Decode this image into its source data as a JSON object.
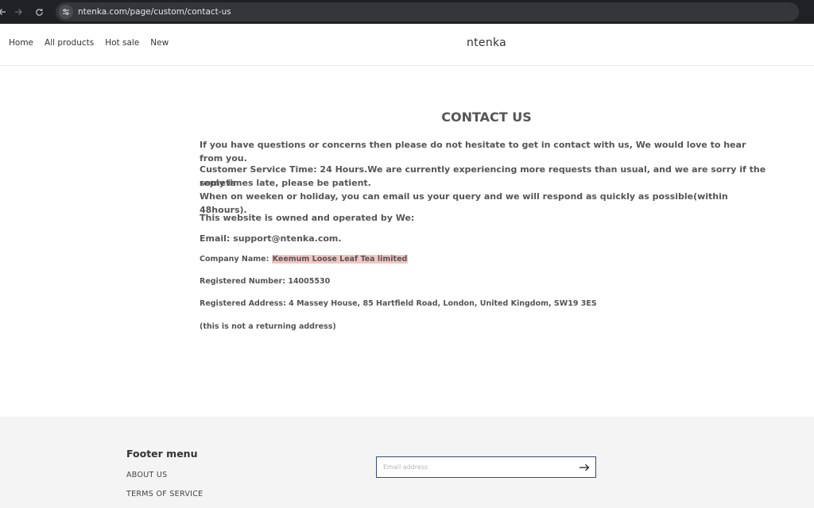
{
  "browser": {
    "url": "ntenka.com/page/custom/contact-us",
    "back_icon": "arrow-left-icon",
    "forward_icon": "arrow-right-icon",
    "reload_icon": "reload-icon",
    "site_info_icon": "tune-icon"
  },
  "header": {
    "nav": [
      "Home",
      "All products",
      "Hot sale",
      "New"
    ],
    "brand": "ntenka"
  },
  "main": {
    "title": "CONTACT US",
    "intro": "If you have questions or concerns then please do not hesitate to get in contact with us, We would love to hear from you.",
    "service_time_1": "Customer Service Time: 24 Hours.We are currently experiencing more requests than usual, and we are sorry if the reply is",
    "service_time_2": "sometimes late, please be patient.",
    "service_time_3": "When on weeken or holiday, you can email us your query and we will respond as quickly as possible(within 48hours).",
    "owned": "This website is owned and operated by We:",
    "email": "Email: support@ntenka.com.",
    "company_label": "Company Name: ",
    "company_name": "Keemum Loose Leaf Tea limited",
    "registered_number": "Registered Number: 14005530",
    "registered_address": "Registered Address: 4 Massey House, 85 Hartfield Road, London, United Kingdom, SW19 3ES",
    "note": "(this is not a returning address)",
    "highlight_color": "#f3c6c4"
  },
  "footer": {
    "title": "Footer menu",
    "links": [
      "ABOUT US",
      "TERMS OF SERVICE"
    ],
    "email_placeholder": "Email address",
    "submit_icon": "arrow-right-icon"
  }
}
